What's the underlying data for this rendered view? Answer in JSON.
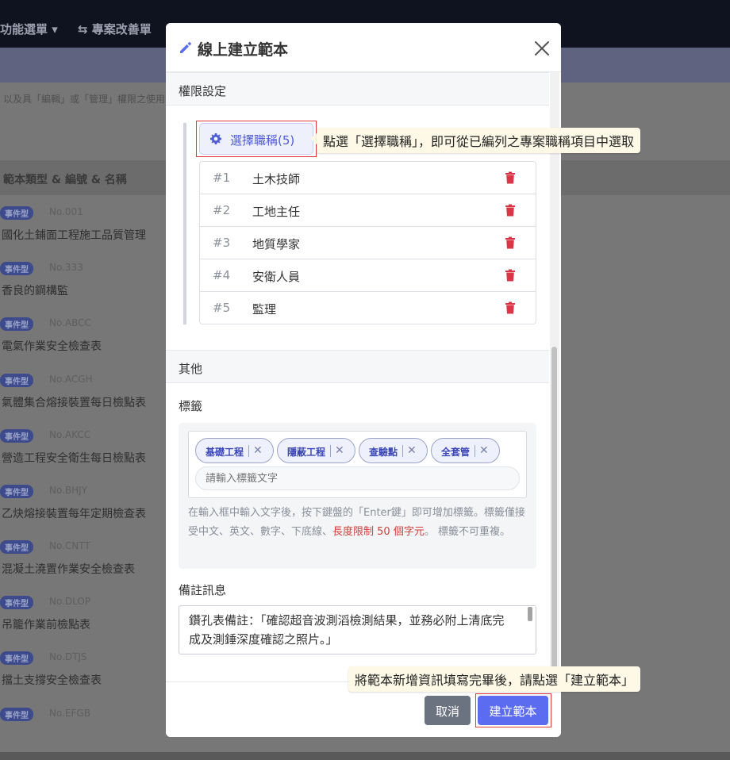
{
  "background": {
    "nav_items": [
      "功能選單 ▾",
      "⇆ 專案改善單"
    ],
    "notice": "以及具「編輯」或「管理」權限之使用者",
    "table_header": "範本類型 & 編號 & 名稱",
    "rows": [
      {
        "badge": "事件型",
        "code": "No.001",
        "name": "國化土鋪面工程施工品質管理"
      },
      {
        "badge": "事件型",
        "code": "No.333",
        "name": "香良的鋼構監"
      },
      {
        "badge": "事件型",
        "code": "No.ABCC",
        "name": "電氣作業安全檢查表"
      },
      {
        "badge": "事件型",
        "code": "No.ACGH",
        "name": "氣體集合熔接裝置每日檢點表"
      },
      {
        "badge": "事件型",
        "code": "No.AKCC",
        "name": "營造工程安全衛生每日檢點表"
      },
      {
        "badge": "事件型",
        "code": "No.BHJY",
        "name": "乙炔熔接裝置每年定期檢查表"
      },
      {
        "badge": "事件型",
        "code": "No.CNTT",
        "name": "混凝土澆置作業安全檢查表"
      },
      {
        "badge": "事件型",
        "code": "No.DLOP",
        "name": "吊籠作業前檢點表"
      },
      {
        "badge": "事件型",
        "code": "No.DTJS",
        "name": "擋土支撐安全檢查表"
      },
      {
        "badge": "事件型",
        "code": "No.EFGB",
        "name": ""
      }
    ]
  },
  "modal": {
    "title": "線上建立範本",
    "permission_section": "權限設定",
    "select_role_button": "選擇職稱(5)",
    "roles": [
      {
        "num": "#1",
        "name": "土木技師"
      },
      {
        "num": "#2",
        "name": "工地主任"
      },
      {
        "num": "#3",
        "name": "地質學家"
      },
      {
        "num": "#4",
        "name": "安衛人員"
      },
      {
        "num": "#5",
        "name": "監理"
      }
    ],
    "other_section": "其他",
    "tags_label": "標籤",
    "tags": [
      "基礎工程",
      "隱蔽工程",
      "查驗點",
      "全套管"
    ],
    "tag_input_placeholder": "請輸入標籤文字",
    "tag_help_1": "在輸入框中輸入文字後，按下鍵盤的「Enter鍵」即可增加標籤。標籤僅接受中文、英文、數字、下底線、",
    "tag_help_red": "長度限制 50 個字元",
    "tag_help_2": "。 標籤不可重複。",
    "note_label": "備註訊息",
    "note_value": "鑽孔表備註：「確認超音波測滔檢測結果，並務必附上清底完成及測錘深度確認之照片。」",
    "cancel_button": "取消",
    "create_button": "建立範本"
  },
  "callouts": {
    "select_role": "點選「選擇職稱」，即可從已編列之專案職稱項目中選取",
    "create": "將範本新增資訊填寫完畢後，請點選「建立範本」"
  },
  "colors": {
    "accent": "#5b6cf0",
    "danger": "#dc3545",
    "highlight_border": "#e03a3a",
    "callout_bg": "#fdf9e6"
  }
}
